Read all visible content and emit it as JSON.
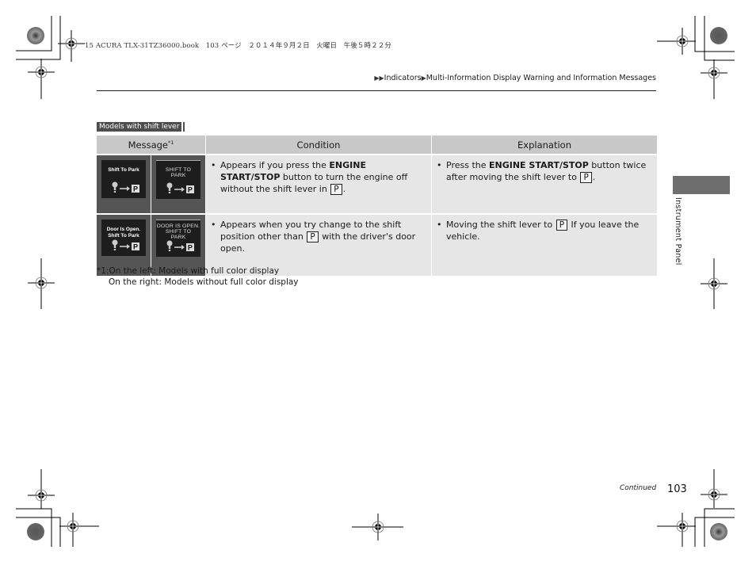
{
  "print_header": "15 ACURA TLX-31TZ36000.book　103 ページ　２０１４年９月２日　火曜日　午後５時２２分",
  "breadcrumb": {
    "arrow_icon": "right-triangle-icon",
    "items": [
      "Indicators",
      "Multi-Information Display Warning and Information Messages"
    ]
  },
  "tag_label": "Models with shift lever",
  "table": {
    "headers": {
      "message": "Message",
      "message_note": "*1",
      "condition": "Condition",
      "explanation": "Explanation"
    },
    "rows": [
      {
        "display_full_color": "Shift To Park",
        "display_mono": [
          "SHIFT TO",
          "PARK"
        ],
        "condition": {
          "pre": "Appears if you press the ",
          "bold": "ENGINE START/STOP",
          "post": " button to turn the engine off without the shift lever in ",
          "gear": "P",
          "end": "."
        },
        "explanation": {
          "pre": "Press the ",
          "bold": "ENGINE START/STOP",
          "post": " button twice after moving the shift lever to ",
          "gear": "P",
          "end": "."
        }
      },
      {
        "display_full_color": [
          "Door Is Open.",
          "Shift To Park"
        ],
        "display_mono": [
          "DOOR IS OPEN.",
          "SHIFT TO",
          "PARK"
        ],
        "condition": {
          "pre": "Appears when you try change to the shift position other than ",
          "gear": "P",
          "post": " with the driver's door open."
        },
        "explanation": {
          "pre": "Moving the shift lever to ",
          "gear": "P",
          "post": " If you leave the vehicle."
        }
      }
    ]
  },
  "footnote": {
    "line1": "*1:On the left: Models with full color display",
    "line2": "On the right: Models without full color display"
  },
  "side_tab": "Instrument Panel",
  "footer": {
    "continued": "Continued",
    "page_number": "103"
  },
  "colors": {
    "header_bg": "#c8c8c8",
    "cell_bg": "#e6e6e6",
    "image_cell_bg": "#555555",
    "tag_bg": "#4d4d4d",
    "side_tab_bg": "#6e6e6e"
  }
}
